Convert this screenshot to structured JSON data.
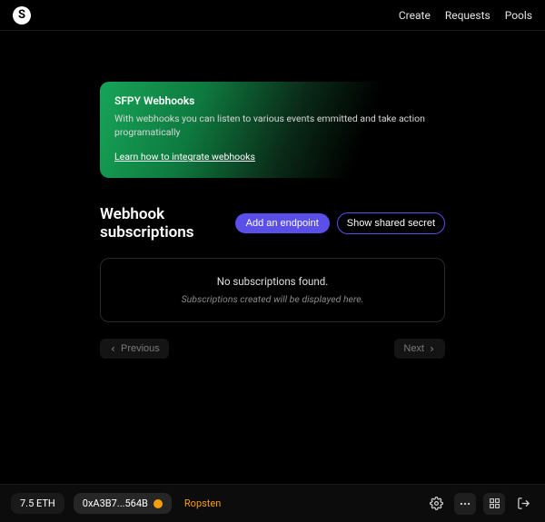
{
  "brand": {
    "logo_letter": "S"
  },
  "nav": {
    "create": "Create",
    "requests": "Requests",
    "pools": "Pools"
  },
  "banner": {
    "title": "SFPY Webhooks",
    "description": "With webhooks you can listen to various events emmitted and take action programatically",
    "link_text": "Learn how to integrate webhooks"
  },
  "section": {
    "title": "Webhook subscriptions",
    "add_button": "Add an endpoint",
    "secret_button": "Show shared secret"
  },
  "empty": {
    "headline": "No subscriptions found.",
    "sub": "Subscriptions created will be displayed here."
  },
  "pager": {
    "previous": "Previous",
    "next": "Next"
  },
  "wallet": {
    "balance": "7.5 ETH",
    "address": "0xA3B7...564B",
    "network": "Ropsten"
  },
  "colors": {
    "accent": "#5b4fe9",
    "banner_green": "#17a558",
    "network_orange": "#f59e0b"
  }
}
